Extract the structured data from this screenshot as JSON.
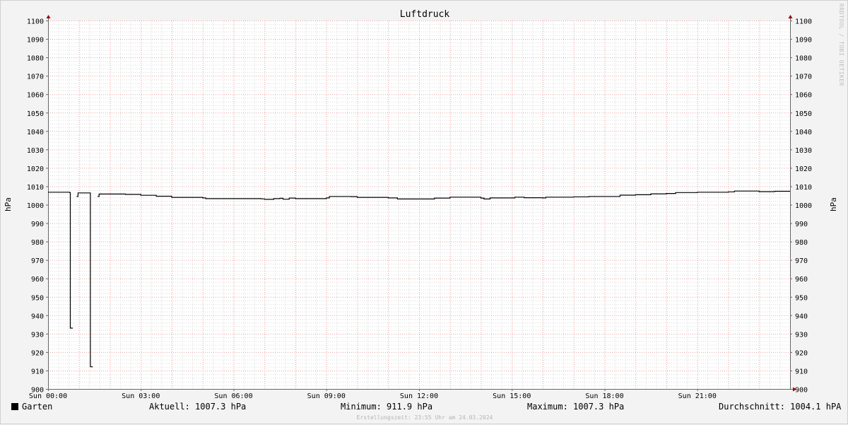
{
  "chart_data": {
    "type": "line",
    "title": "Luftdruck",
    "ylabel": "hPa",
    "ylabel_right": "hPa",
    "ylim": [
      900,
      1100
    ],
    "xlim_hours": [
      0,
      24
    ],
    "yticks": [
      900,
      910,
      920,
      930,
      940,
      950,
      960,
      970,
      980,
      990,
      1000,
      1010,
      1020,
      1030,
      1040,
      1050,
      1060,
      1070,
      1080,
      1090,
      1100
    ],
    "xticks": [
      {
        "hour": 0,
        "label": "Sun 00:00"
      },
      {
        "hour": 3,
        "label": "Sun 03:00"
      },
      {
        "hour": 6,
        "label": "Sun 06:00"
      },
      {
        "hour": 9,
        "label": "Sun 09:00"
      },
      {
        "hour": 12,
        "label": "Sun 12:00"
      },
      {
        "hour": 15,
        "label": "Sun 15:00"
      },
      {
        "hour": 18,
        "label": "Sun 18:00"
      },
      {
        "hour": 21,
        "label": "Sun 21:00"
      }
    ],
    "series": [
      {
        "name": "Garten",
        "color": "#000000",
        "segments": [
          [
            [
              0.0,
              1006.8
            ],
            [
              0.7,
              1006.6
            ],
            [
              0.72,
              933.0
            ],
            [
              0.8,
              933.0
            ]
          ],
          [
            [
              0.92,
              1004.5
            ],
            [
              0.97,
              1006.4
            ],
            [
              1.35,
              1006.4
            ],
            [
              1.37,
              912.0
            ],
            [
              1.45,
              912.0
            ]
          ],
          [
            [
              1.6,
              1004.5
            ],
            [
              1.65,
              1005.8
            ],
            [
              2.5,
              1005.6
            ],
            [
              3.0,
              1005.1
            ],
            [
              3.5,
              1004.6
            ],
            [
              4.0,
              1004.0
            ],
            [
              5.0,
              1003.7
            ],
            [
              5.1,
              1003.3
            ],
            [
              6.0,
              1003.3
            ],
            [
              6.9,
              1003.2
            ],
            [
              7.0,
              1002.9
            ],
            [
              7.3,
              1003.3
            ],
            [
              7.5,
              1003.5
            ],
            [
              7.6,
              1003.0
            ],
            [
              7.8,
              1003.6
            ],
            [
              8.0,
              1003.3
            ],
            [
              9.0,
              1003.7
            ],
            [
              9.1,
              1004.5
            ],
            [
              9.8,
              1004.4
            ],
            [
              10.0,
              1004.0
            ],
            [
              11.0,
              1003.7
            ],
            [
              11.3,
              1003.1
            ],
            [
              12.0,
              1003.1
            ],
            [
              12.5,
              1003.6
            ],
            [
              13.0,
              1004.1
            ],
            [
              14.0,
              1003.6
            ],
            [
              14.1,
              1003.1
            ],
            [
              14.3,
              1003.7
            ],
            [
              15.0,
              1003.7
            ],
            [
              15.1,
              1004.1
            ],
            [
              15.4,
              1003.8
            ],
            [
              16.0,
              1003.7
            ],
            [
              16.1,
              1004.1
            ],
            [
              17.0,
              1004.3
            ],
            [
              17.5,
              1004.5
            ],
            [
              18.0,
              1004.5
            ],
            [
              18.5,
              1005.2
            ],
            [
              19.0,
              1005.4
            ],
            [
              19.5,
              1005.9
            ],
            [
              20.0,
              1006.1
            ],
            [
              20.3,
              1006.6
            ],
            [
              21.0,
              1006.8
            ],
            [
              22.0,
              1007.0
            ],
            [
              22.2,
              1007.4
            ],
            [
              23.0,
              1007.1
            ],
            [
              23.5,
              1007.3
            ],
            [
              23.92,
              1007.3
            ],
            [
              24.0,
              1007.3
            ]
          ]
        ]
      }
    ]
  },
  "legend": {
    "series_name": "Garten",
    "current": "Aktuell: 1007.3 hPa",
    "minimum": "Minimum: 911.9 hPa",
    "maximum": "Maximum: 1007.3 hPa",
    "average": "Durchschnitt: 1004.1 hPA"
  },
  "footer": "Erstellungszeit: 23:55 Uhr am 24.03.2024",
  "watermark": "RRDTOOL / TOBI OETIKER",
  "colors": {
    "background": "#f3f3f3",
    "plot_background": "#ffffff",
    "major_grid": "#e8a0a0",
    "minor_grid": "#d9d9d9",
    "axis": "#666666",
    "line": "#000000",
    "arrow": "#a00000"
  }
}
